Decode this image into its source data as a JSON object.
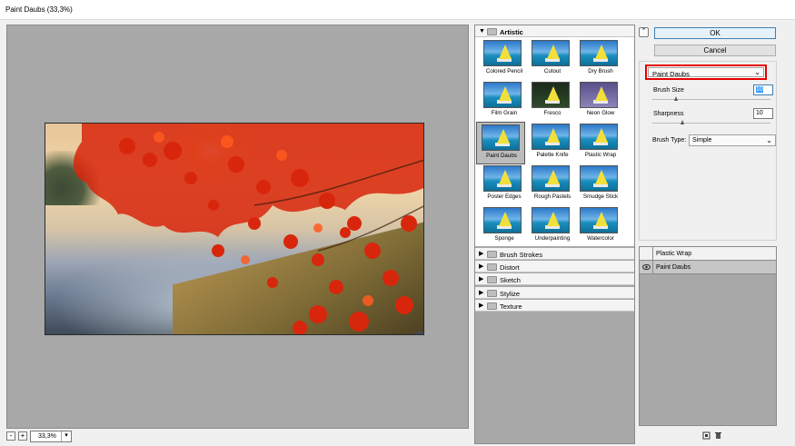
{
  "window": {
    "title": "Paint Daubs (33,3%)"
  },
  "zoom": {
    "minus": "-",
    "plus": "+",
    "value": "33,3%"
  },
  "gallery": {
    "open_category": "Artistic",
    "filters": [
      {
        "label": "Colored Pencil"
      },
      {
        "label": "Cutout"
      },
      {
        "label": "Dry Brush"
      },
      {
        "label": "Film Grain"
      },
      {
        "label": "Fresco"
      },
      {
        "label": "Neon Glow"
      },
      {
        "label": "Paint Daubs"
      },
      {
        "label": "Palette Knife"
      },
      {
        "label": "Plastic Wrap"
      },
      {
        "label": "Poster Edges"
      },
      {
        "label": "Rough Pastels"
      },
      {
        "label": "Smudge Stick"
      },
      {
        "label": "Sponge"
      },
      {
        "label": "Underpainting"
      },
      {
        "label": "Watercolor"
      }
    ],
    "selected_filter": "Paint Daubs",
    "collapsed_categories": [
      "Brush Strokes",
      "Distort",
      "Sketch",
      "Stylize",
      "Texture"
    ]
  },
  "buttons": {
    "ok": "OK",
    "cancel": "Cancel"
  },
  "settings": {
    "filter_select": "Paint Daubs",
    "brush_size_label": "Brush Size",
    "brush_size_value": "10",
    "brush_size_level": 0.2,
    "sharpness_label": "Sharpness",
    "sharpness_value": "10",
    "sharpness_level": 0.25,
    "brush_type_label": "Brush Type:",
    "brush_type_value": "Simple"
  },
  "layers": [
    {
      "name": "Plastic Wrap",
      "visible": false
    },
    {
      "name": "Paint Daubs",
      "visible": true
    }
  ],
  "colors": {
    "highlight": "#e60000",
    "panel_gray": "#a8a8a8",
    "accent": "#3c7fb1"
  }
}
